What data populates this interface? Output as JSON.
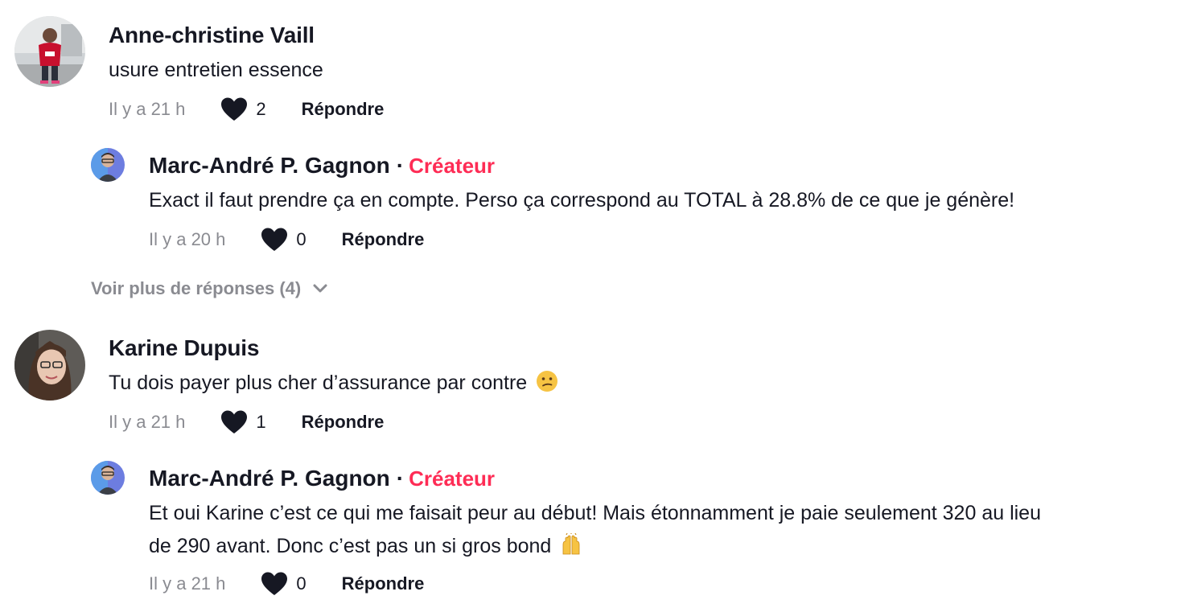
{
  "comments": [
    {
      "author": "Anne-christine Vaill",
      "text": "usure entretien essence",
      "time": "Il y a 21 h",
      "likes": "2",
      "reply_label": "Répondre",
      "replies": [
        {
          "author": "Marc-André P. Gagnon",
          "badge": "Créateur",
          "text": "Exact il faut prendre ça en compte. Perso ça correspond au TOTAL à 28.8% de ce que je génère!",
          "time": "Il y a 20 h",
          "likes": "0",
          "reply_label": "Répondre"
        }
      ],
      "more_replies": "Voir plus de réponses (4)"
    },
    {
      "author": "Karine Dupuis",
      "text": "Tu dois payer plus cher d’assurance par contre",
      "text_emoji": "confused-face",
      "time": "Il y a 21 h",
      "likes": "1",
      "reply_label": "Répondre",
      "replies": [
        {
          "author": "Marc-André P. Gagnon",
          "badge": "Créateur",
          "text_line1": "Et oui Karine c’est ce qui me faisait peur au début! Mais étonnamment je paie seulement 320 au lieu",
          "text_line2": "de 290 avant. Donc c’est pas un si gros bond",
          "text_emoji": "raising-hands",
          "time": "Il y a 21 h",
          "likes": "0",
          "reply_label": "Répondre"
        }
      ]
    }
  ],
  "colors": {
    "creator_badge": "#fe2c55",
    "meta_gray": "#8a8b91",
    "text": "#161823"
  },
  "icons": {
    "like": "heart-icon",
    "expand": "chevron-down-icon"
  }
}
